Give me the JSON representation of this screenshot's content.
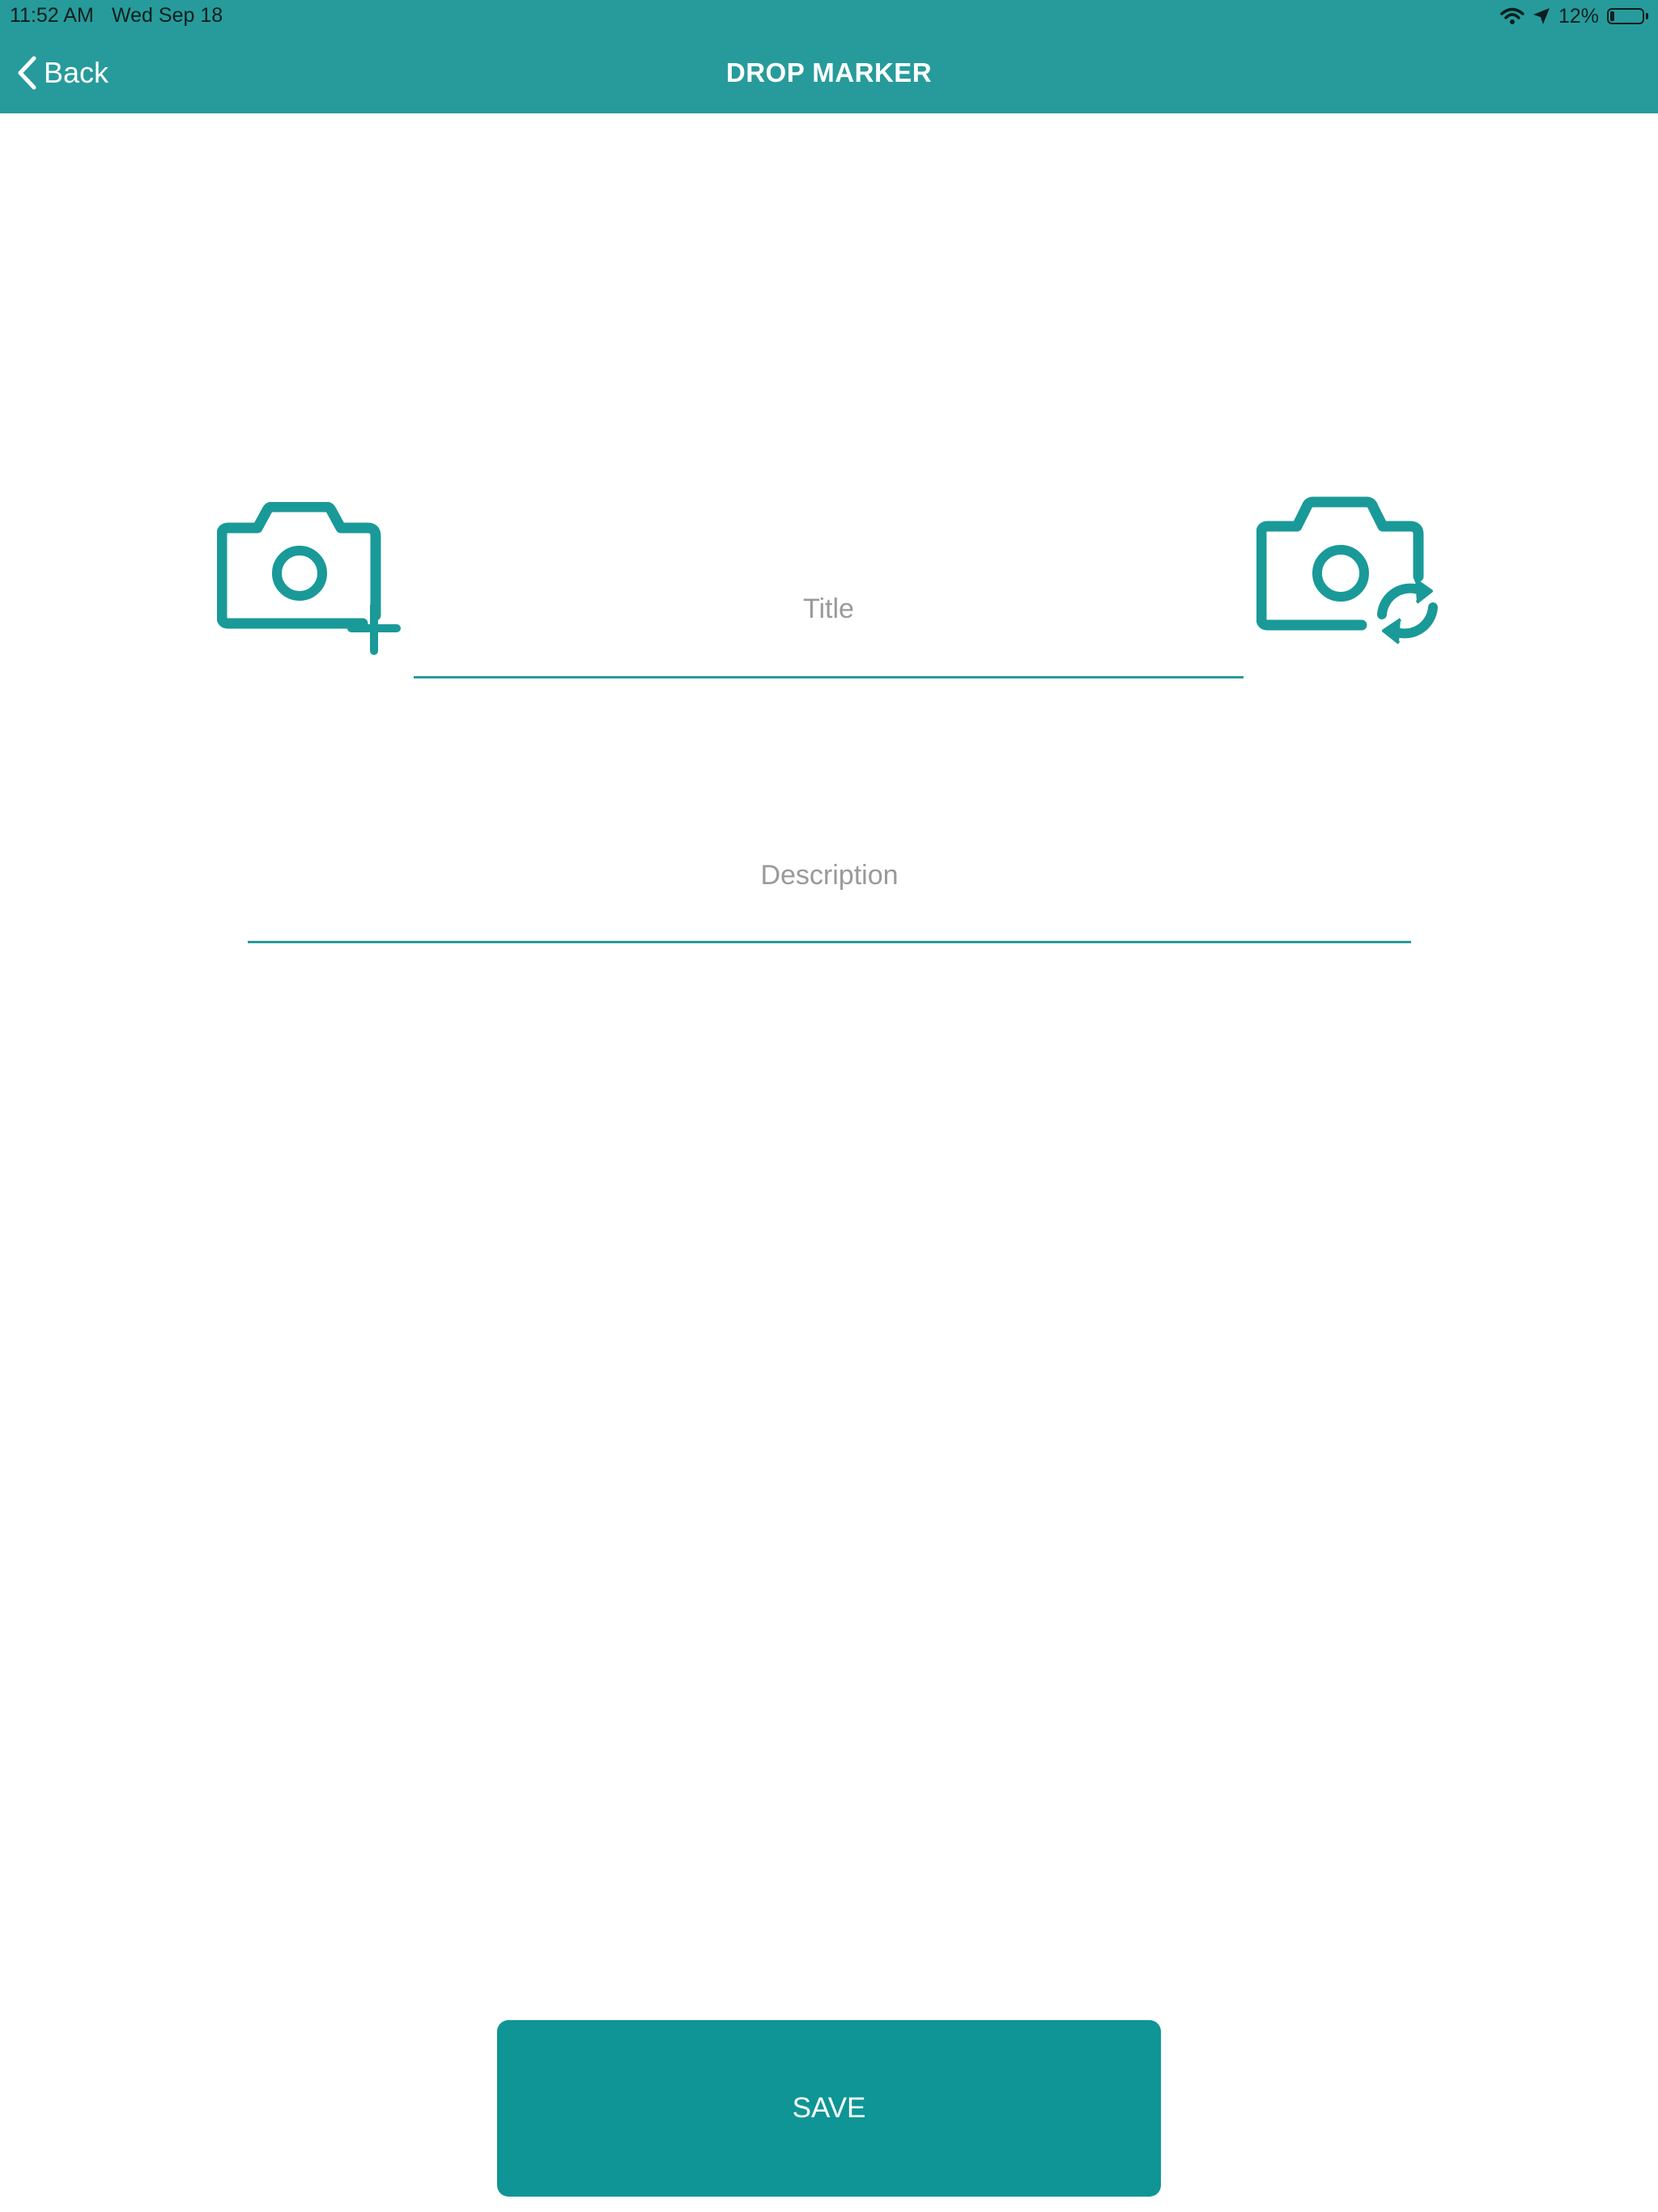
{
  "status_bar": {
    "time": "11:52 AM",
    "date": "Wed Sep 18",
    "battery_percent": "12%",
    "battery_level": 0.12,
    "icons": [
      "wifi-icon",
      "location-arrow-icon",
      "battery-icon"
    ]
  },
  "nav": {
    "back_label": "Back",
    "title": "DROP MARKER"
  },
  "form": {
    "add_photo_icon": "camera-plus-icon",
    "switch_camera_icon": "camera-switch-icon",
    "title_placeholder": "Title",
    "title_value": "",
    "description_placeholder": "Description",
    "description_value": ""
  },
  "actions": {
    "save_label": "SAVE"
  },
  "colors": {
    "header": "#279b9b",
    "accent": "#1a9999",
    "save_button": "#0f9595",
    "placeholder": "#9a9a9a"
  }
}
